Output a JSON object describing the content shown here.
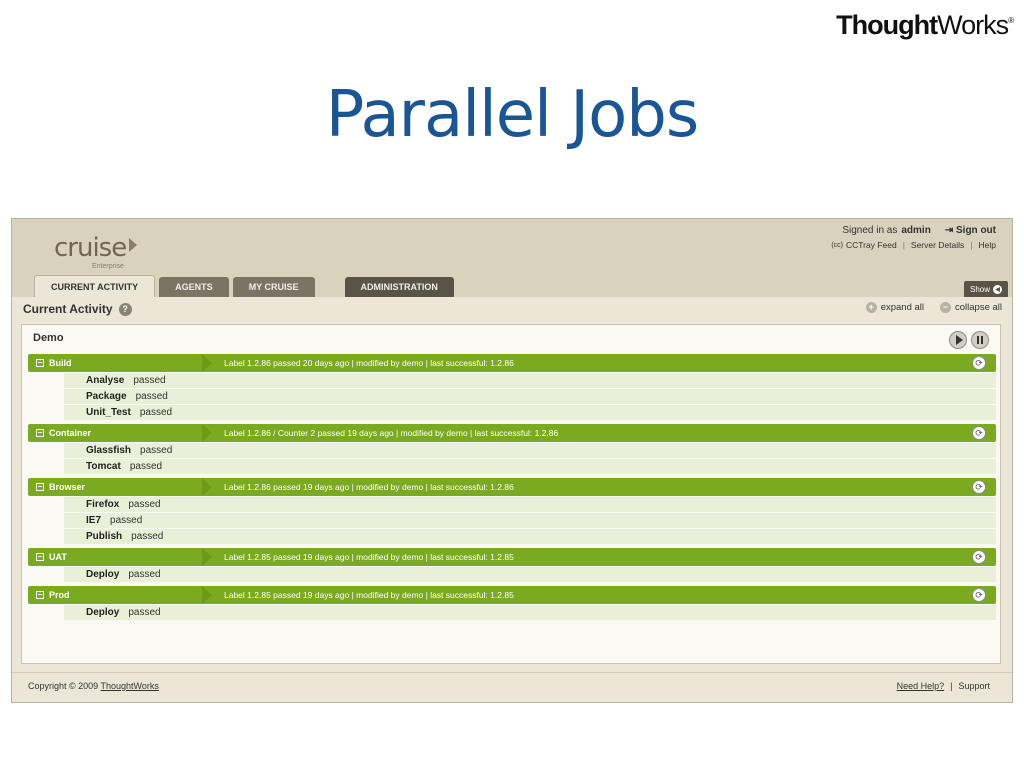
{
  "brand": {
    "logo_bold": "Thought",
    "logo_regular": "Works",
    "logo_mark": "®"
  },
  "slide": {
    "title": "Parallel Jobs"
  },
  "app": {
    "logo_word": "cruise",
    "logo_sub": "Enterprise",
    "user": {
      "signed_in_prefix": "Signed in as",
      "username": "admin",
      "sign_out": "Sign out",
      "cc_mark": "(cc)",
      "cctray": "CCTray Feed",
      "server_details": "Server Details",
      "help": "Help"
    },
    "tabs": [
      {
        "label": "CURRENT ACTIVITY"
      },
      {
        "label": "AGENTS"
      },
      {
        "label": "MY CRUISE"
      },
      {
        "label": "ADMINISTRATION"
      }
    ],
    "show_label": "Show",
    "current_activity": {
      "title": "Current Activity",
      "help_mark": "?",
      "expand_all": "expand all",
      "collapse_all": "collapse all"
    },
    "pipeline": {
      "name": "Demo",
      "stages": [
        {
          "name": "Build",
          "info": "Label 1.2.86 passed 20 days ago | modified by demo | last successful: 1.2.86",
          "jobs": [
            {
              "name": "Analyse",
              "status": "passed"
            },
            {
              "name": "Package",
              "status": "passed"
            },
            {
              "name": "Unit_Test",
              "status": "passed"
            }
          ]
        },
        {
          "name": "Container",
          "info": "Label 1.2.86 / Counter 2 passed 19 days ago | modified by demo | last successful: 1.2.86",
          "jobs": [
            {
              "name": "Glassfish",
              "status": "passed"
            },
            {
              "name": "Tomcat",
              "status": "passed"
            }
          ]
        },
        {
          "name": "Browser",
          "info": "Label 1.2.86 passed 19 days ago | modified by demo | last successful: 1.2.86",
          "jobs": [
            {
              "name": "Firefox",
              "status": "passed"
            },
            {
              "name": "IE7",
              "status": "passed"
            },
            {
              "name": "Publish",
              "status": "passed"
            }
          ]
        },
        {
          "name": "UAT",
          "info": "Label 1.2.85 passed 19 days ago | modified by demo | last successful: 1.2.85",
          "jobs": [
            {
              "name": "Deploy",
              "status": "passed"
            }
          ]
        },
        {
          "name": "Prod",
          "info": "Label 1.2.85 passed 19 days ago | modified by demo | last successful: 1.2.85",
          "jobs": [
            {
              "name": "Deploy",
              "status": "passed"
            }
          ]
        }
      ]
    },
    "footer": {
      "copyright_prefix": "Copyright © 2009",
      "copyright_link": "ThoughtWorks",
      "need_help": "Need Help?",
      "support": "Support"
    }
  },
  "icons": {
    "toggle": "collapse-toggle-icon",
    "refresh": "refresh-icon",
    "play": "play-icon",
    "pause": "pause-icon",
    "help": "help-icon",
    "expand": "plus-icon",
    "collapse": "minus-icon"
  },
  "colors": {
    "title_blue": "#1a5696",
    "stage_green": "#7aaa1f",
    "job_row": "#eaf0d8",
    "header_bg": "#d9d2bd",
    "app_bg": "#ece6d6"
  }
}
